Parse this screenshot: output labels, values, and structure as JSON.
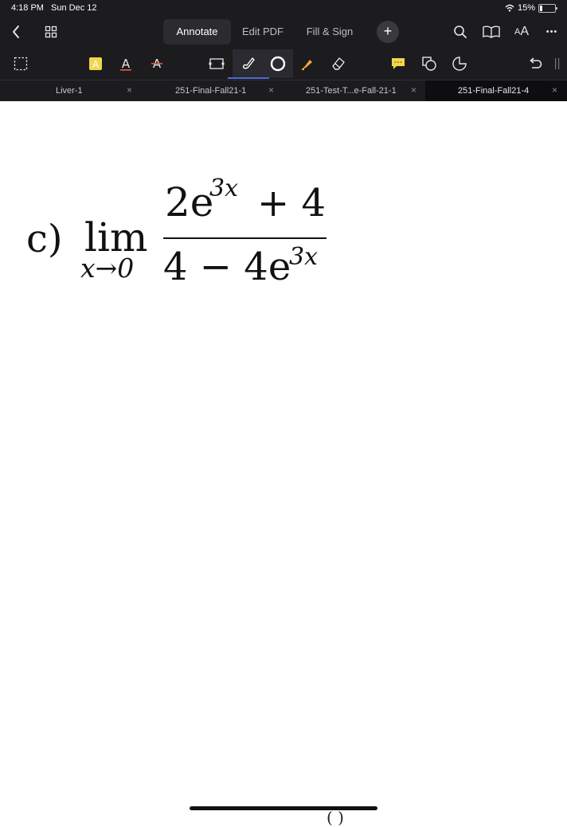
{
  "status": {
    "time": "4:18 PM",
    "date": "Sun Dec 12",
    "battery": "15%",
    "battery_level": 0.15
  },
  "nav": {
    "tabs": [
      {
        "label": "Annotate",
        "active": true
      },
      {
        "label": "Edit PDF",
        "active": false
      },
      {
        "label": "Fill & Sign",
        "active": false
      }
    ],
    "plus_label": "+",
    "font_size_label": "AA",
    "more_label": "•••"
  },
  "toolbar": {
    "selected_tool": "pen",
    "accent_color": "#4a6cd4",
    "highlight_color": "#f2d64b"
  },
  "doc_tabs": [
    {
      "label": "Liver-1",
      "close": "×",
      "active": false
    },
    {
      "label": "251-Final-Fall21-1",
      "close": "×",
      "active": false
    },
    {
      "label": "251-Test-T...e-Fall-21-1",
      "close": "×",
      "active": false
    },
    {
      "label": "251-Final-Fall21-4",
      "close": "×",
      "active": true
    }
  ],
  "page": {
    "label": "c)",
    "lim": "lim",
    "lim_sub": "x→0",
    "numerator": {
      "base": "2e",
      "exp": "3x",
      "rest": "+ 4"
    },
    "denominator": {
      "base": "4 − 4e",
      "exp": "3x"
    },
    "bottom_cut_text": "(      )"
  }
}
